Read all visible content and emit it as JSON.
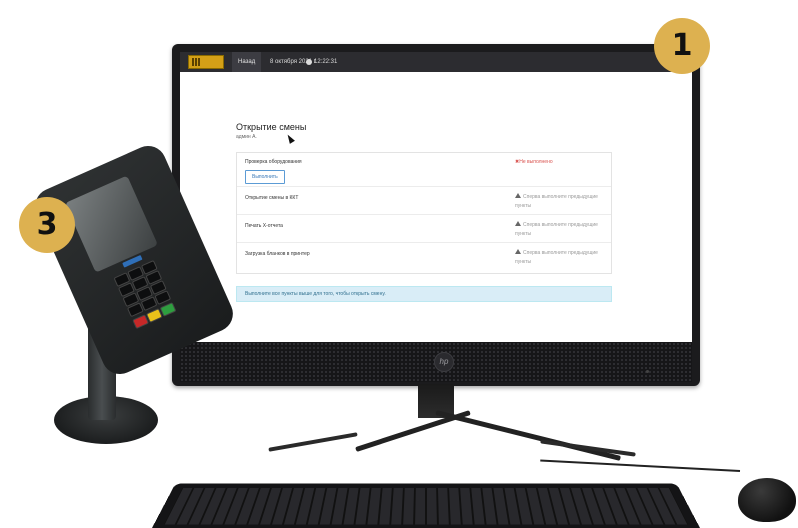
{
  "app": {
    "back_label": "Назад",
    "date_label": "8 октября 2021 г.",
    "time_label": "12:22:31"
  },
  "page": {
    "title": "Открытие смены",
    "user": "админ А."
  },
  "steps": [
    {
      "label": "Проверка оборудования",
      "status": "Не выполнено",
      "status_type": "error",
      "action": "Выполнить"
    },
    {
      "label": "Открытие смены в ККТ",
      "status": "Сперва выполните предыдущие пункты",
      "status_type": "warning"
    },
    {
      "label": "Печать X-отчета",
      "status": "Сперва выполните предыдущие пункты",
      "status_type": "warning"
    },
    {
      "label": "Загрузка бланков в принтер",
      "status": "Сперва выполните предыдущие пункты",
      "status_type": "warning"
    }
  ],
  "alert": {
    "text": "Выполните все пункты выше для того, чтобы открыть смену."
  },
  "badges": {
    "monitor_number": "1",
    "terminal_number": "3"
  },
  "colors": {
    "badge": "#ddb150",
    "alert_bg": "#d9edf7",
    "error": "#d9534f",
    "navbar": "#2c2c30"
  },
  "icons": [
    "clock-icon",
    "warning-icon",
    "cross-icon",
    "mouse-cursor-icon",
    "hp-logo-icon"
  ]
}
